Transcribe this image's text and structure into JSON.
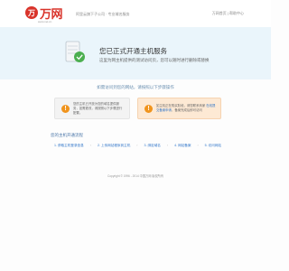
{
  "header": {
    "logo_mark": "万",
    "logo_text": "万网",
    "logo_sub": "www.net.cn",
    "tagline": "阿里云旗下子公司 · 专业域名服务",
    "links": "万网首页 | 帮助中心"
  },
  "hero": {
    "title": "您已正式开通主机服务",
    "subtitle": "这里为网主机提供的测试访问页，您可以随时进行删除或替换"
  },
  "notice": {
    "label": "如需访问到您的网站，请按照以下步骤操作"
  },
  "panels": {
    "left": {
      "badge": "!",
      "text": "您的主机已开放为您的域名提供服务，如需更改，请按照以下步骤进行配置。"
    },
    "right": {
      "badge": "!",
      "text": "如主机正在购买阶段，请您联系商家 ",
      "link": "在线提交备案申请",
      "text_after": "，备案完成后即可访问"
    }
  },
  "steps": {
    "title": "您的主机开通流程",
    "items": [
      {
        "label": "1. 获取主机登录信息"
      },
      {
        "label": "2. 上传网站程序到主机"
      },
      {
        "label": "3. 绑定域名"
      },
      {
        "label": "4. 网站备案"
      },
      {
        "label": "5. 访问网站"
      }
    ],
    "arrow": "›"
  },
  "footer": {
    "text": "Copyright © 1996 - 2014 中国万网 版权所有"
  },
  "colors": {
    "brand": "#d9342b",
    "hero_bg": "#eaf5fb",
    "link": "#2f75c9",
    "badge": "#f0941d"
  }
}
